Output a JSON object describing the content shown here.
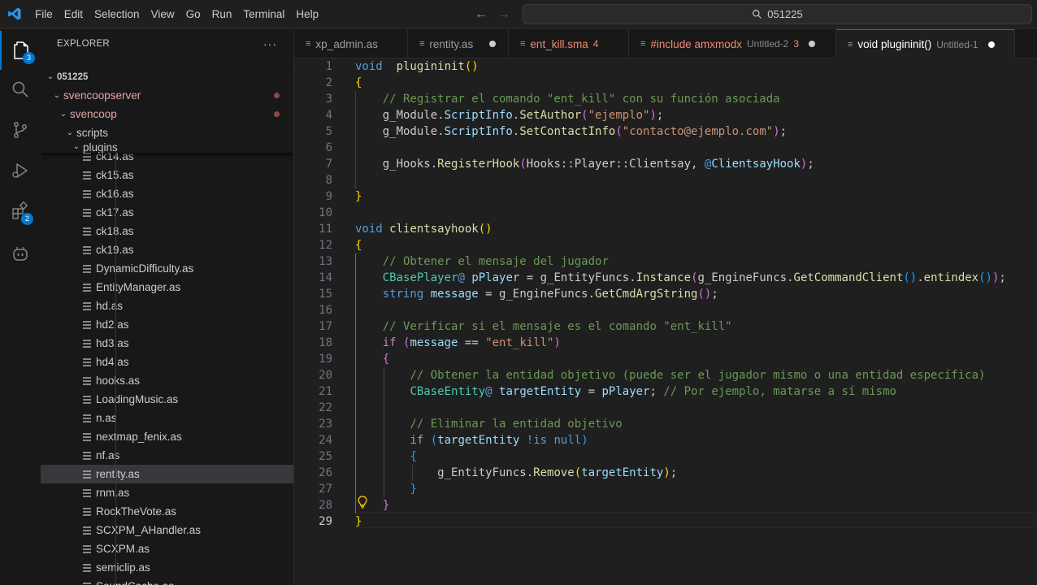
{
  "menu": [
    "File",
    "Edit",
    "Selection",
    "View",
    "Go",
    "Run",
    "Terminal",
    "Help"
  ],
  "search": {
    "text": "051225",
    "icon": "search-icon"
  },
  "activity": {
    "explorer_badge": "3",
    "extensions_badge": "2"
  },
  "sidebar": {
    "title": "EXPLORER",
    "more": "···",
    "root": "051225",
    "folders": [
      "svencoopserver",
      "svencoop",
      "scripts",
      "plugins"
    ],
    "files": [
      "ck14.as",
      "ck15.as",
      "ck16.as",
      "ck17.as",
      "ck18.as",
      "ck19.as",
      "DynamicDifficulty.as",
      "EntityManager.as",
      "hd.as",
      "hd2.as",
      "hd3.as",
      "hd4.as",
      "hooks.as",
      "LoadingMusic.as",
      "n.as",
      "nextmap_fenix.as",
      "nf.as",
      "rentity.as",
      "rnm.as",
      "RockTheVote.as",
      "SCXPM_AHandler.as",
      "SCXPM.as",
      "semiclip.as",
      "SoundCache.as"
    ],
    "selected_file": "rentity.as"
  },
  "tabs": [
    {
      "label": "xp_admin.as",
      "desc": "",
      "count": "",
      "modified": false
    },
    {
      "label": "rentity.as",
      "desc": "",
      "count": "",
      "modified": true
    },
    {
      "label": "ent_kill.sma",
      "desc": "",
      "count": "4",
      "modified": false
    },
    {
      "label": "#include amxmodx",
      "desc": "Untitled-2",
      "count": "3",
      "modified": true
    },
    {
      "label": "void plugininit()",
      "desc": "Untitled-1",
      "count": "",
      "modified": true
    }
  ],
  "editor": {
    "line_numbers": [
      "1",
      "2",
      "3",
      "4",
      "5",
      "6",
      "7",
      "8",
      "9",
      "10",
      "11",
      "12",
      "13",
      "14",
      "15",
      "16",
      "17",
      "18",
      "19",
      "20",
      "21",
      "22",
      "23",
      "24",
      "25",
      "26",
      "27",
      "28",
      "29"
    ],
    "current_line": "29",
    "lines": [
      [
        [
          "kw",
          "void"
        ],
        [
          "",
          "  "
        ],
        [
          "fn",
          "plugininit"
        ],
        [
          "br1",
          "()"
        ]
      ],
      [
        [
          "br1",
          "{"
        ]
      ],
      [
        [
          "",
          "    "
        ],
        [
          "cmt",
          "// Registrar el comando \"ent_kill\" con su función asociada"
        ]
      ],
      [
        [
          "",
          "    g_Module."
        ],
        [
          "var",
          "ScriptInfo"
        ],
        [
          "",
          "."
        ],
        [
          "fn",
          "SetAuthor"
        ],
        [
          "br2",
          "("
        ],
        [
          "str",
          "\"ejemplo\""
        ],
        [
          "br2",
          ")"
        ],
        [
          "",
          ";"
        ]
      ],
      [
        [
          "",
          "    g_Module."
        ],
        [
          "var",
          "ScriptInfo"
        ],
        [
          "",
          "."
        ],
        [
          "fn",
          "SetContactInfo"
        ],
        [
          "br2",
          "("
        ],
        [
          "str",
          "\"contacto@ejemplo.com\""
        ],
        [
          "br2",
          ")"
        ],
        [
          "",
          ";"
        ]
      ],
      [],
      [
        [
          "",
          "    g_Hooks."
        ],
        [
          "fn",
          "RegisterHook"
        ],
        [
          "br2",
          "("
        ],
        [
          "",
          "Hooks::Player::Clientsay, "
        ],
        [
          "kw",
          "@"
        ],
        [
          "var",
          "ClientsayHook"
        ],
        [
          "br2",
          ")"
        ],
        [
          "",
          ";"
        ]
      ],
      [],
      [
        [
          "br1",
          "}"
        ]
      ],
      [],
      [
        [
          "kw",
          "void"
        ],
        [
          "",
          ""
        ],
        [
          "fn",
          " clientsayhook"
        ],
        [
          "br1",
          "()"
        ]
      ],
      [
        [
          "br1",
          "{"
        ]
      ],
      [
        [
          "",
          "    "
        ],
        [
          "cmt",
          "// Obtener el mensaje del jugador"
        ]
      ],
      [
        [
          "",
          "    "
        ],
        [
          "ty",
          "CBasePlayer"
        ],
        [
          "kw",
          "@"
        ],
        [
          "",
          " "
        ],
        [
          "var",
          "pPlayer"
        ],
        [
          "",
          " = g_EntityFuncs."
        ],
        [
          "fn",
          "Instance"
        ],
        [
          "br2",
          "("
        ],
        [
          "",
          "g_EngineFuncs."
        ],
        [
          "fn",
          "GetCommandClient"
        ],
        [
          "br3",
          "()"
        ],
        [
          "",
          "."
        ],
        [
          "fn",
          "entindex"
        ],
        [
          "br3",
          "()"
        ],
        [
          "br2",
          ")"
        ],
        [
          "",
          ";"
        ]
      ],
      [
        [
          "",
          "    "
        ],
        [
          "kw",
          "string"
        ],
        [
          "",
          " "
        ],
        [
          "var",
          "message"
        ],
        [
          "",
          " = g_EngineFuncs."
        ],
        [
          "fn",
          "GetCmdArgString"
        ],
        [
          "br2",
          "()"
        ],
        [
          "",
          ";"
        ]
      ],
      [],
      [
        [
          "",
          "    "
        ],
        [
          "cmt",
          "// Verificar si el mensaje es el comando \"ent_kill\""
        ]
      ],
      [
        [
          "",
          "    "
        ],
        [
          "ctl",
          "if"
        ],
        [
          "",
          " "
        ],
        [
          "br2",
          "("
        ],
        [
          "var",
          "message"
        ],
        [
          "",
          " == "
        ],
        [
          "str",
          "\"ent_kill\""
        ],
        [
          "br2",
          ")"
        ]
      ],
      [
        [
          "",
          "    "
        ],
        [
          "br2",
          "{"
        ]
      ],
      [
        [
          "",
          "        "
        ],
        [
          "cmt",
          "// Obtener la entidad objetivo (puede ser el jugador mismo o una entidad específica)"
        ]
      ],
      [
        [
          "",
          "        "
        ],
        [
          "ty",
          "CBaseEntity"
        ],
        [
          "kw",
          "@"
        ],
        [
          "",
          " "
        ],
        [
          "var",
          "targetEntity"
        ],
        [
          "",
          " = "
        ],
        [
          "var",
          "pPlayer"
        ],
        [
          "",
          "; "
        ],
        [
          "cmt",
          "// Por ejemplo, matarse a sí mismo"
        ]
      ],
      [],
      [
        [
          "",
          "        "
        ],
        [
          "cmt",
          "// Eliminar la entidad objetivo"
        ]
      ],
      [
        [
          "",
          "        "
        ],
        [
          "ctl",
          "if"
        ],
        [
          "",
          " "
        ],
        [
          "br3",
          "("
        ],
        [
          "var",
          "targetEntity"
        ],
        [
          "",
          " "
        ],
        [
          "kw",
          "!is"
        ],
        [
          "",
          " "
        ],
        [
          "kw",
          "null"
        ],
        [
          "br3",
          ")"
        ]
      ],
      [
        [
          "",
          "        "
        ],
        [
          "br3",
          "{"
        ]
      ],
      [
        [
          "",
          "            g_EntityFuncs."
        ],
        [
          "fn",
          "Remove"
        ],
        [
          "br1",
          "("
        ],
        [
          "var",
          "targetEntity"
        ],
        [
          "br1",
          ")"
        ],
        [
          "",
          ";"
        ]
      ],
      [
        [
          "",
          "        "
        ],
        [
          "br3",
          "}"
        ]
      ],
      [
        [
          "",
          "    "
        ],
        [
          "br2",
          "}"
        ]
      ],
      [
        [
          "br1",
          "}"
        ]
      ]
    ]
  }
}
